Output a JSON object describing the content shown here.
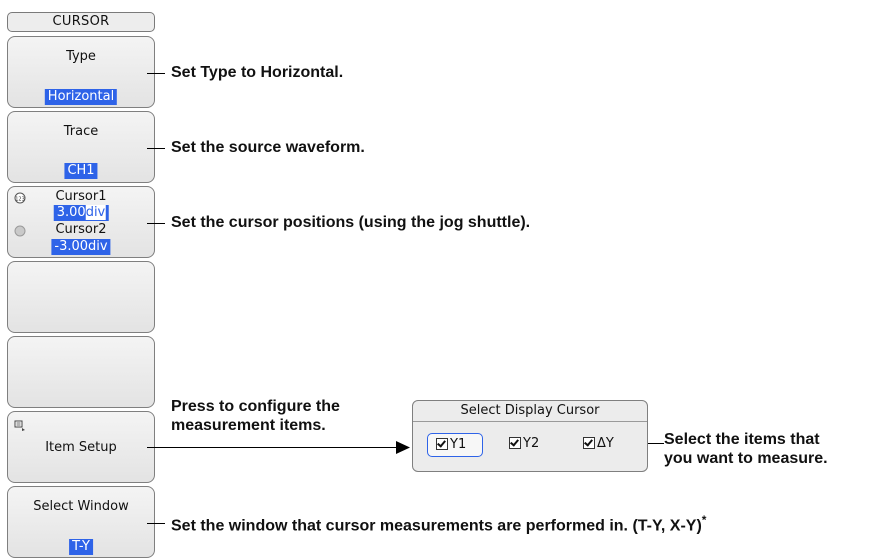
{
  "menu": {
    "title": "CURSOR",
    "keys": {
      "type": {
        "label": "Type",
        "value": "Horizontal"
      },
      "trace": {
        "label": "Trace",
        "value": "CH1"
      },
      "cursor1": {
        "label": "Cursor1",
        "value_num": "3.00",
        "value_unit": "div"
      },
      "cursor2": {
        "label": "Cursor2",
        "value": "-3.00div"
      },
      "item_setup": {
        "label": "Item Setup"
      },
      "select_window": {
        "label": "Select Window",
        "value": "T-Y"
      }
    }
  },
  "annotations": {
    "type": "Set Type to Horizontal.",
    "trace": "Set the source waveform.",
    "cursor": "Set the cursor positions (using the jog shuttle).",
    "item_setup_line1": "Press to configure the",
    "item_setup_line2": "measurement items.",
    "select_items_line1": "Select the items that",
    "select_items_line2": "you want to measure.",
    "window": "Set the window that cursor measurements are performed in. (T-Y, X-Y)",
    "window_mark": "*"
  },
  "dialog": {
    "title": "Select Display Cursor",
    "items": [
      {
        "label": "Y1",
        "checked": true,
        "selected": true
      },
      {
        "label": "Y2",
        "checked": true
      },
      {
        "label": "ΔY",
        "checked": true
      }
    ]
  },
  "colors": {
    "highlight": "#2e63e8",
    "key_face": "#e8e8e8"
  },
  "icons": [
    "jog-dial-icon",
    "item-setup-icon"
  ]
}
